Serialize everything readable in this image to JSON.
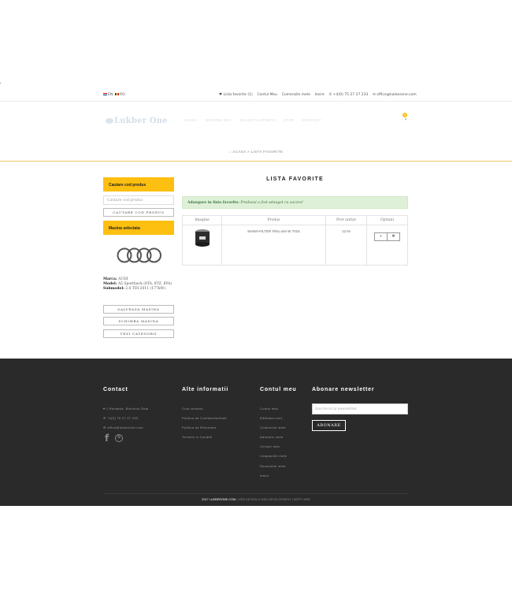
{
  "topbar": {
    "lang_en": "EN",
    "lang_ro": "RO",
    "favorites": "Lista favorite (1)",
    "account": "Contul Meu",
    "orders": "Comenzile mele",
    "logout": "Iesire",
    "phone": "+4(0) 75 27 27 233",
    "email": "office@lukberone.com"
  },
  "header": {
    "logo": "Lukber One",
    "nav": [
      "Acasa",
      "Despre noi",
      "Solicita oferta",
      "Stiri",
      "Contact"
    ],
    "cart_count": "0"
  },
  "breadcrumb": {
    "home": "ACASA",
    "sep": ">",
    "current": "LISTA FAVORITE"
  },
  "sidebar": {
    "search_title": "Cautare cod produs",
    "search_placeholder": "Cautare cod produs",
    "search_button": "Cautare cod produs",
    "car_title": "Masina selectata",
    "brand_label": "Marca:",
    "brand_value": "AUDI",
    "model_label": "Model:",
    "model_value": "A5 Sportback (8TA, 8TZ, 8YA)",
    "submodel_label": "Submodel:",
    "submodel_value": "2.0 TDI 2011 (177kW)",
    "save_car": "Salveaza masina",
    "change_car": "Schimba masina",
    "categories": "Vezi categorii"
  },
  "main": {
    "title": "LISTA FAVORITE",
    "alert_strong": "Adaugare in lista favorite:",
    "alert_text": "Produsul a fost adaugat cu succes!",
    "table": {
      "headers": [
        "Imagine",
        "Produs",
        "Pret unitar",
        "Optiuni"
      ],
      "rows": [
        {
          "product": "MANN-FILTER Filtru ulei W 7015",
          "price": "12 lei",
          "cart_icon": "cart-icon",
          "delete_icon": "delete-icon"
        }
      ]
    }
  },
  "footer": {
    "contact_title": "Contact",
    "address": "1 Romania, Bulrichin Deal",
    "phone": "+4(0) 75 27 27 233",
    "email": "office@lukberone.com",
    "info_title": "Alte informatii",
    "info_links": [
      "Cum comand",
      "Politica de Confidentialitate",
      "Politica de Returnare",
      "Termeni si Conditii"
    ],
    "account_title": "Contul meu",
    "account_links": [
      "Contul meu",
      "Editeaza cont",
      "Comenzile mele",
      "Adresele mele",
      "Cerdurl mes",
      "Campaniile mele",
      "Recenziile mele",
      "Iesire"
    ],
    "newsletter_title": "Abonare newsletter",
    "newsletter_placeholder": "Inscrie-te la newsletter",
    "newsletter_button": "ABONARE",
    "copyright_brand": "2017 LUKBERONE.COM",
    "copyright_rest": " | WEB DESIGN & WEB DEVELOPMENT: HAPPY WEB"
  }
}
